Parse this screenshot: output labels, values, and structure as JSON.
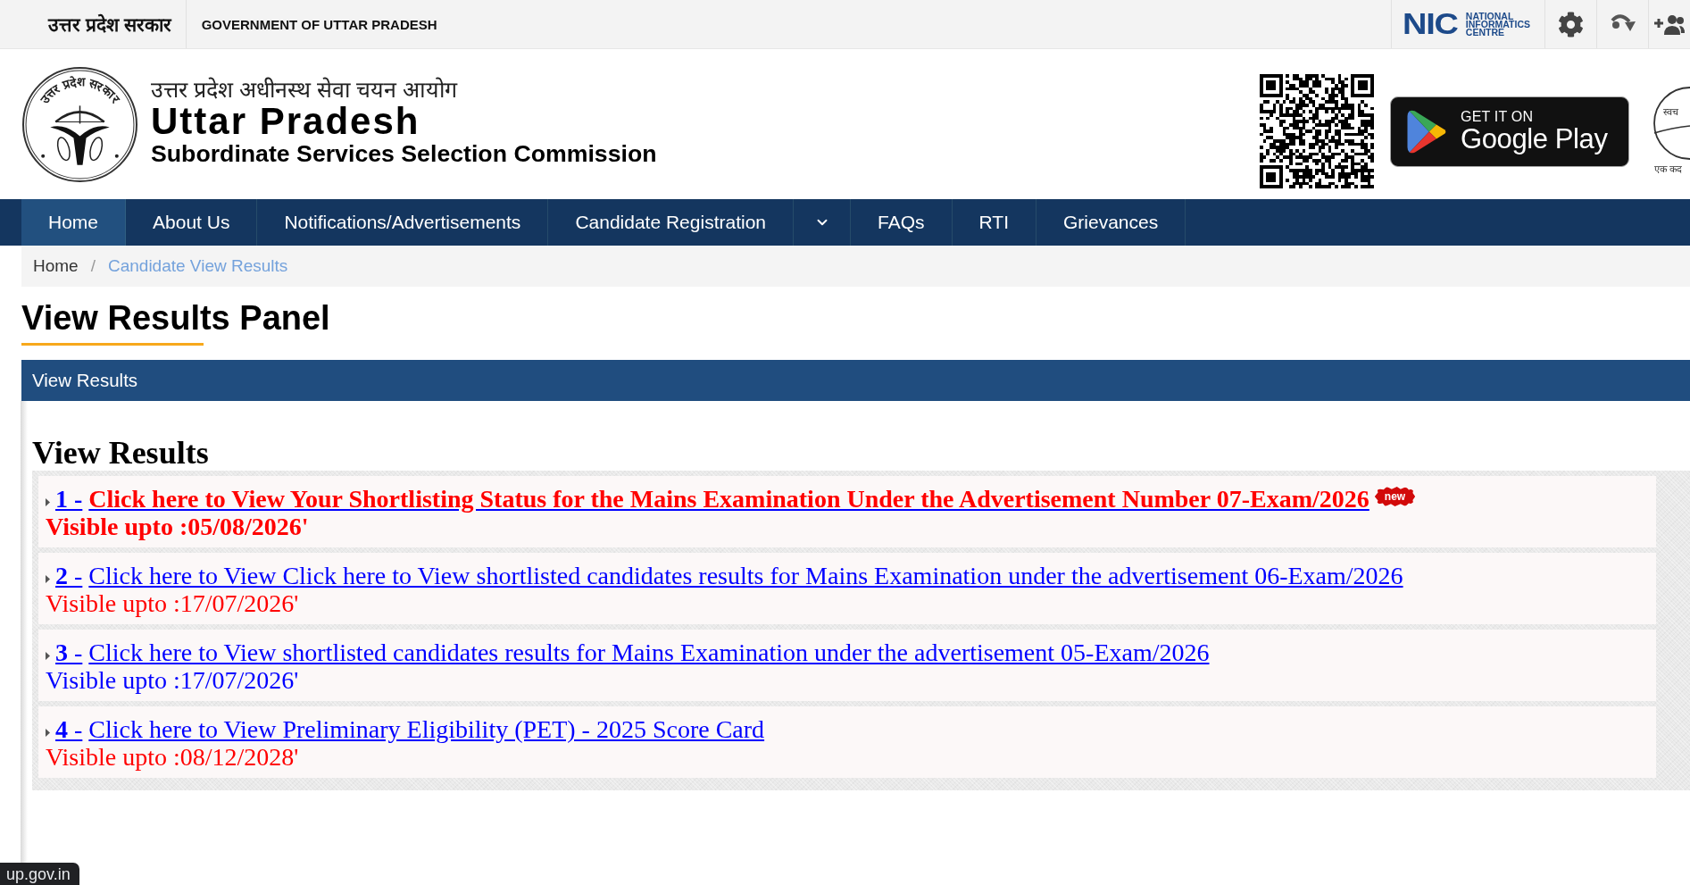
{
  "top_bar": {
    "state_name": "उत्तर प्रदेश सरकार",
    "government": "GOVERNMENT OF UTTAR PRADESH",
    "nic_logo": {
      "mark": "NIC",
      "name": "NATIONAL INFORMATICS CENTRE"
    }
  },
  "header": {
    "emblem_legend": "उत्तर प्रदेश सरकार",
    "title_hindi": "उत्तर प्रदेश अधीनस्थ सेवा चयन आयोग",
    "title": "Uttar Pradesh",
    "subtitle": "Subordinate Services Selection Commission",
    "store_badge": {
      "caption": "GET IT ON",
      "store": "Google Play"
    },
    "swachh_logo": {
      "text": "स्वच",
      "slogan": "एक कद"
    }
  },
  "nav": [
    {
      "label": "Home",
      "selected": true,
      "has_dropdown": false
    },
    {
      "label": "About Us",
      "selected": false,
      "has_dropdown": false
    },
    {
      "label": "Notifications/Advertisements",
      "selected": false,
      "has_dropdown": false
    },
    {
      "label": "Candidate Registration",
      "selected": false,
      "has_dropdown": true
    },
    {
      "label": "FAQs",
      "selected": false,
      "has_dropdown": false
    },
    {
      "label": "RTI",
      "selected": false,
      "has_dropdown": false
    },
    {
      "label": "Grievances",
      "selected": false,
      "has_dropdown": false
    }
  ],
  "breadcrumb": {
    "separator": "/",
    "items": [
      {
        "label": "Home",
        "current": false
      },
      {
        "label": "Candidate View Results",
        "current": true
      }
    ]
  },
  "page_title": "View Results Panel",
  "panel": {
    "title": "View Results",
    "heading": "View Results",
    "results": [
      {
        "number": "**1** -",
        "title": "Click here to View Your Shortlisting Status for the Mains Examination Under the Advertisement Number 07-Exam/2026",
        "color": "#ff0000",
        "bold": true,
        "badge": "new",
        "validity": {
          "text": "Visible upto :05/08/2026'",
          "color": "#ff0000"
        }
      },
      {
        "number": "**2** -",
        "title": "Click here to View Click here to View shortlisted candidates results for Mains Examination under the advertisement 06-Exam/2026",
        "color": "#0000ff",
        "bold": false,
        "validity": {
          "text": "Visible upto :17/07/2026'",
          "color": "#ff0000"
        }
      },
      {
        "number": "**3** -",
        "title": "Click here to View shortlisted candidates results for Mains Examination under the advertisement 05-Exam/2026",
        "color": "#0000ff",
        "bold": false,
        "validity": {
          "text": "Visible upto :17/07/2026'",
          "color": "#0000ff"
        }
      },
      {
        "number": "**4** -",
        "title": "Click here to View Preliminary Eligibility (PET) - 2025 Score Card",
        "color": "#0000ff",
        "bold": false,
        "validity": {
          "text": "Visible upto :08/12/2028'",
          "color": "#ff0000"
        }
      }
    ]
  },
  "status_url": "up.gov.in"
}
